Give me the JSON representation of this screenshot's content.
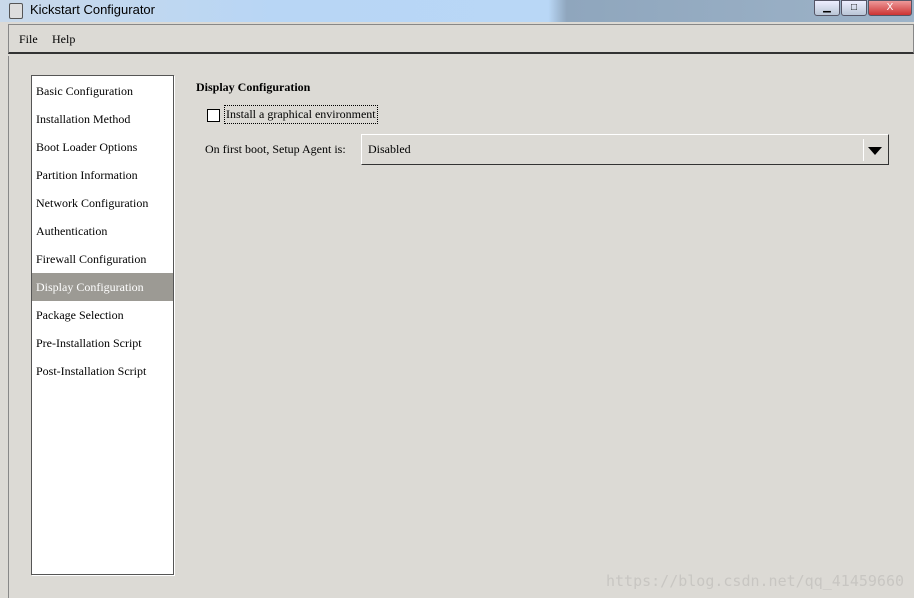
{
  "window": {
    "title": "Kickstart Configurator",
    "minimize": "▁",
    "maximize": "□",
    "close": "X"
  },
  "menu": {
    "file": "File",
    "help": "Help"
  },
  "sidebar": {
    "items": [
      {
        "label": "Basic Configuration"
      },
      {
        "label": "Installation Method"
      },
      {
        "label": "Boot Loader Options"
      },
      {
        "label": "Partition Information"
      },
      {
        "label": "Network Configuration"
      },
      {
        "label": "Authentication"
      },
      {
        "label": "Firewall Configuration"
      },
      {
        "label": "Display Configuration",
        "selected": true
      },
      {
        "label": "Package Selection"
      },
      {
        "label": "Pre-Installation Script"
      },
      {
        "label": "Post-Installation Script"
      }
    ]
  },
  "content": {
    "title": "Display Configuration",
    "install_graphical": {
      "label": "Install a graphical environment",
      "checked": false
    },
    "setup_agent": {
      "label": "On first boot, Setup Agent is:",
      "value": "Disabled"
    }
  },
  "watermark": "https://blog.csdn.net/qq_41459660"
}
